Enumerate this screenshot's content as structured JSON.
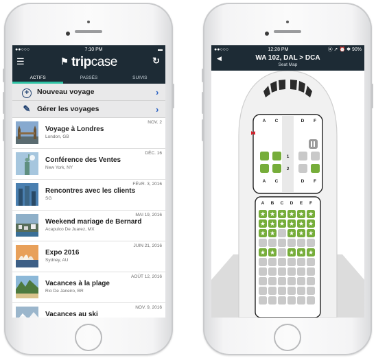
{
  "left": {
    "status": {
      "carrier": "●●○○○",
      "time": "7:10 PM",
      "battery": "▬"
    },
    "logo": {
      "bold": "trip",
      "light": "case"
    },
    "tabs": [
      {
        "label": "ACTIFS"
      },
      {
        "label": "PASSÉS"
      },
      {
        "label": "SUIVIS"
      }
    ],
    "actions": [
      {
        "label": "Nouveau voyage",
        "icon": "+"
      },
      {
        "label": "Gérer les voyages",
        "icon": "✎"
      }
    ],
    "trips": [
      {
        "date": "NOV. 2",
        "name": "Voyage à Londres",
        "loc": "London, GB"
      },
      {
        "date": "DÉC. 16",
        "name": "Conférence des Ventes",
        "loc": "New York, NY"
      },
      {
        "date": "FÉVR. 3, 2016",
        "name": "Rencontres avec les clients",
        "loc": "SG"
      },
      {
        "date": "MAI 19, 2016",
        "name": "Weekend mariage de Bernard",
        "loc": "Acapulco De Juarez, MX"
      },
      {
        "date": "JUIN 21, 2016",
        "name": "Expo 2016",
        "loc": "Sydney, AU"
      },
      {
        "date": "AOÛT 12, 2016",
        "name": "Vacances à la plage",
        "loc": "Rio De Janeiro, BR"
      },
      {
        "date": "NOV. 9, 2016",
        "name": "Vacances au ski",
        "loc": ""
      }
    ],
    "colors": {
      "header": "#1d2b35",
      "accent": "#2fc4a5",
      "link": "#2c63c4"
    }
  },
  "right": {
    "status": {
      "carrier": "●●○○○",
      "time": "12:28 PM",
      "icons": "⦿ ➚ ⏰ ✱ 90%"
    },
    "header": {
      "route": "WA 102, DAL > DCA",
      "subtitle": "Seat Map",
      "back": "◀"
    },
    "first_class": {
      "columns_top": [
        "A",
        "C",
        "D",
        "F"
      ],
      "columns_bottom": [
        "A",
        "C",
        "D",
        "F"
      ],
      "rows": [
        {
          "number": "1",
          "seats": [
            "available",
            "available",
            "occupied",
            "occupied"
          ]
        },
        {
          "number": "2",
          "seats": [
            "available",
            "available",
            "occupied",
            "available"
          ]
        }
      ]
    },
    "economy": {
      "columns": [
        "A",
        "B",
        "C",
        "D",
        "E",
        "F"
      ],
      "rows": [
        [
          "premium",
          "premium",
          "premium",
          "premium",
          "premium",
          "premium"
        ],
        [
          "premium",
          "premium",
          "premium",
          "premium",
          "premium",
          "premium"
        ],
        [
          "premium",
          "premium",
          "occupied",
          "premium",
          "premium",
          "premium"
        ],
        [
          "occupied",
          "occupied",
          "occupied",
          "occupied",
          "occupied",
          "occupied"
        ],
        [
          "premium",
          "premium",
          "occupied",
          "premium",
          "premium",
          "premium"
        ],
        [
          "occupied",
          "occupied",
          "occupied",
          "occupied",
          "occupied",
          "occupied"
        ],
        [
          "occupied",
          "occupied",
          "occupied",
          "occupied",
          "occupied",
          "occupied"
        ],
        [
          "occupied",
          "occupied",
          "occupied",
          "occupied",
          "occupied",
          "occupied"
        ],
        [
          "occupied",
          "occupied",
          "occupied",
          "occupied",
          "occupied",
          "occupied"
        ],
        [
          "occupied",
          "occupied",
          "occupied",
          "occupied",
          "occupied",
          "occupied"
        ]
      ]
    },
    "colors": {
      "available": "#76ad3a",
      "occupied": "#c9c9c9",
      "exit": "#d9212b"
    }
  }
}
